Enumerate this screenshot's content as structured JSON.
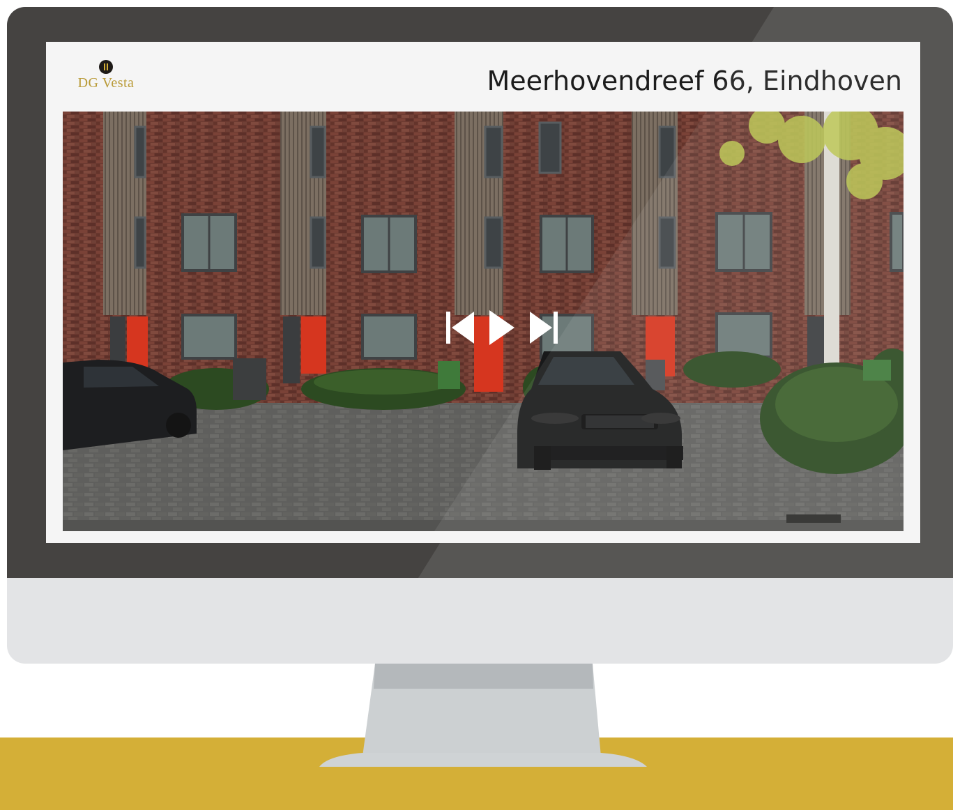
{
  "brand": {
    "name": "DG Vesta",
    "icon": "dg-vesta-logo-icon",
    "color": "#b99a36"
  },
  "property": {
    "address": "Meerhovendreef 66, Eindhoven"
  },
  "player": {
    "controls": [
      {
        "name": "previous",
        "icon": "skip-previous-icon"
      },
      {
        "name": "play",
        "icon": "play-icon"
      },
      {
        "name": "next",
        "icon": "skip-next-icon"
      }
    ]
  },
  "colors": {
    "floor": "#d4af37",
    "bezel": "#454341",
    "chin": "#e3e4e6",
    "stand": "#ccd0d2",
    "door": "#d6361f",
    "brick": "#6f3c32"
  }
}
